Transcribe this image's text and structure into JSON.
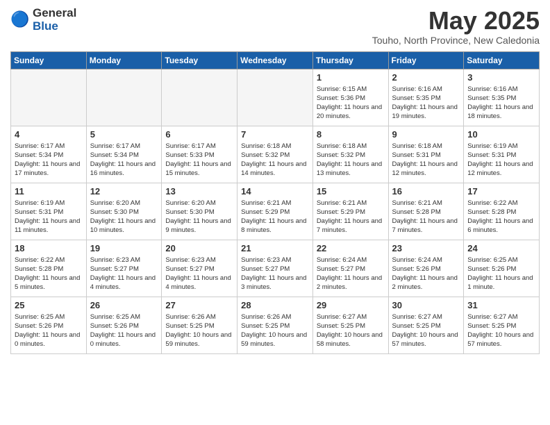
{
  "logo": {
    "general": "General",
    "blue": "Blue"
  },
  "header": {
    "month": "May 2025",
    "subtitle": "Touho, North Province, New Caledonia"
  },
  "weekdays": [
    "Sunday",
    "Monday",
    "Tuesday",
    "Wednesday",
    "Thursday",
    "Friday",
    "Saturday"
  ],
  "weeks": [
    [
      {
        "day": "",
        "empty": true
      },
      {
        "day": "",
        "empty": true
      },
      {
        "day": "",
        "empty": true
      },
      {
        "day": "",
        "empty": true
      },
      {
        "day": "1",
        "sunrise": "6:15 AM",
        "sunset": "5:36 PM",
        "daylight": "11 hours and 20 minutes."
      },
      {
        "day": "2",
        "sunrise": "6:16 AM",
        "sunset": "5:35 PM",
        "daylight": "11 hours and 19 minutes."
      },
      {
        "day": "3",
        "sunrise": "6:16 AM",
        "sunset": "5:35 PM",
        "daylight": "11 hours and 18 minutes."
      }
    ],
    [
      {
        "day": "4",
        "sunrise": "6:17 AM",
        "sunset": "5:34 PM",
        "daylight": "11 hours and 17 minutes."
      },
      {
        "day": "5",
        "sunrise": "6:17 AM",
        "sunset": "5:34 PM",
        "daylight": "11 hours and 16 minutes."
      },
      {
        "day": "6",
        "sunrise": "6:17 AM",
        "sunset": "5:33 PM",
        "daylight": "11 hours and 15 minutes."
      },
      {
        "day": "7",
        "sunrise": "6:18 AM",
        "sunset": "5:32 PM",
        "daylight": "11 hours and 14 minutes."
      },
      {
        "day": "8",
        "sunrise": "6:18 AM",
        "sunset": "5:32 PM",
        "daylight": "11 hours and 13 minutes."
      },
      {
        "day": "9",
        "sunrise": "6:18 AM",
        "sunset": "5:31 PM",
        "daylight": "11 hours and 12 minutes."
      },
      {
        "day": "10",
        "sunrise": "6:19 AM",
        "sunset": "5:31 PM",
        "daylight": "11 hours and 12 minutes."
      }
    ],
    [
      {
        "day": "11",
        "sunrise": "6:19 AM",
        "sunset": "5:31 PM",
        "daylight": "11 hours and 11 minutes."
      },
      {
        "day": "12",
        "sunrise": "6:20 AM",
        "sunset": "5:30 PM",
        "daylight": "11 hours and 10 minutes."
      },
      {
        "day": "13",
        "sunrise": "6:20 AM",
        "sunset": "5:30 PM",
        "daylight": "11 hours and 9 minutes."
      },
      {
        "day": "14",
        "sunrise": "6:21 AM",
        "sunset": "5:29 PM",
        "daylight": "11 hours and 8 minutes."
      },
      {
        "day": "15",
        "sunrise": "6:21 AM",
        "sunset": "5:29 PM",
        "daylight": "11 hours and 7 minutes."
      },
      {
        "day": "16",
        "sunrise": "6:21 AM",
        "sunset": "5:28 PM",
        "daylight": "11 hours and 7 minutes."
      },
      {
        "day": "17",
        "sunrise": "6:22 AM",
        "sunset": "5:28 PM",
        "daylight": "11 hours and 6 minutes."
      }
    ],
    [
      {
        "day": "18",
        "sunrise": "6:22 AM",
        "sunset": "5:28 PM",
        "daylight": "11 hours and 5 minutes."
      },
      {
        "day": "19",
        "sunrise": "6:23 AM",
        "sunset": "5:27 PM",
        "daylight": "11 hours and 4 minutes."
      },
      {
        "day": "20",
        "sunrise": "6:23 AM",
        "sunset": "5:27 PM",
        "daylight": "11 hours and 4 minutes."
      },
      {
        "day": "21",
        "sunrise": "6:23 AM",
        "sunset": "5:27 PM",
        "daylight": "11 hours and 3 minutes."
      },
      {
        "day": "22",
        "sunrise": "6:24 AM",
        "sunset": "5:27 PM",
        "daylight": "11 hours and 2 minutes."
      },
      {
        "day": "23",
        "sunrise": "6:24 AM",
        "sunset": "5:26 PM",
        "daylight": "11 hours and 2 minutes."
      },
      {
        "day": "24",
        "sunrise": "6:25 AM",
        "sunset": "5:26 PM",
        "daylight": "11 hours and 1 minute."
      }
    ],
    [
      {
        "day": "25",
        "sunrise": "6:25 AM",
        "sunset": "5:26 PM",
        "daylight": "11 hours and 0 minutes."
      },
      {
        "day": "26",
        "sunrise": "6:25 AM",
        "sunset": "5:26 PM",
        "daylight": "11 hours and 0 minutes."
      },
      {
        "day": "27",
        "sunrise": "6:26 AM",
        "sunset": "5:25 PM",
        "daylight": "10 hours and 59 minutes."
      },
      {
        "day": "28",
        "sunrise": "6:26 AM",
        "sunset": "5:25 PM",
        "daylight": "10 hours and 59 minutes."
      },
      {
        "day": "29",
        "sunrise": "6:27 AM",
        "sunset": "5:25 PM",
        "daylight": "10 hours and 58 minutes."
      },
      {
        "day": "30",
        "sunrise": "6:27 AM",
        "sunset": "5:25 PM",
        "daylight": "10 hours and 57 minutes."
      },
      {
        "day": "31",
        "sunrise": "6:27 AM",
        "sunset": "5:25 PM",
        "daylight": "10 hours and 57 minutes."
      }
    ]
  ]
}
